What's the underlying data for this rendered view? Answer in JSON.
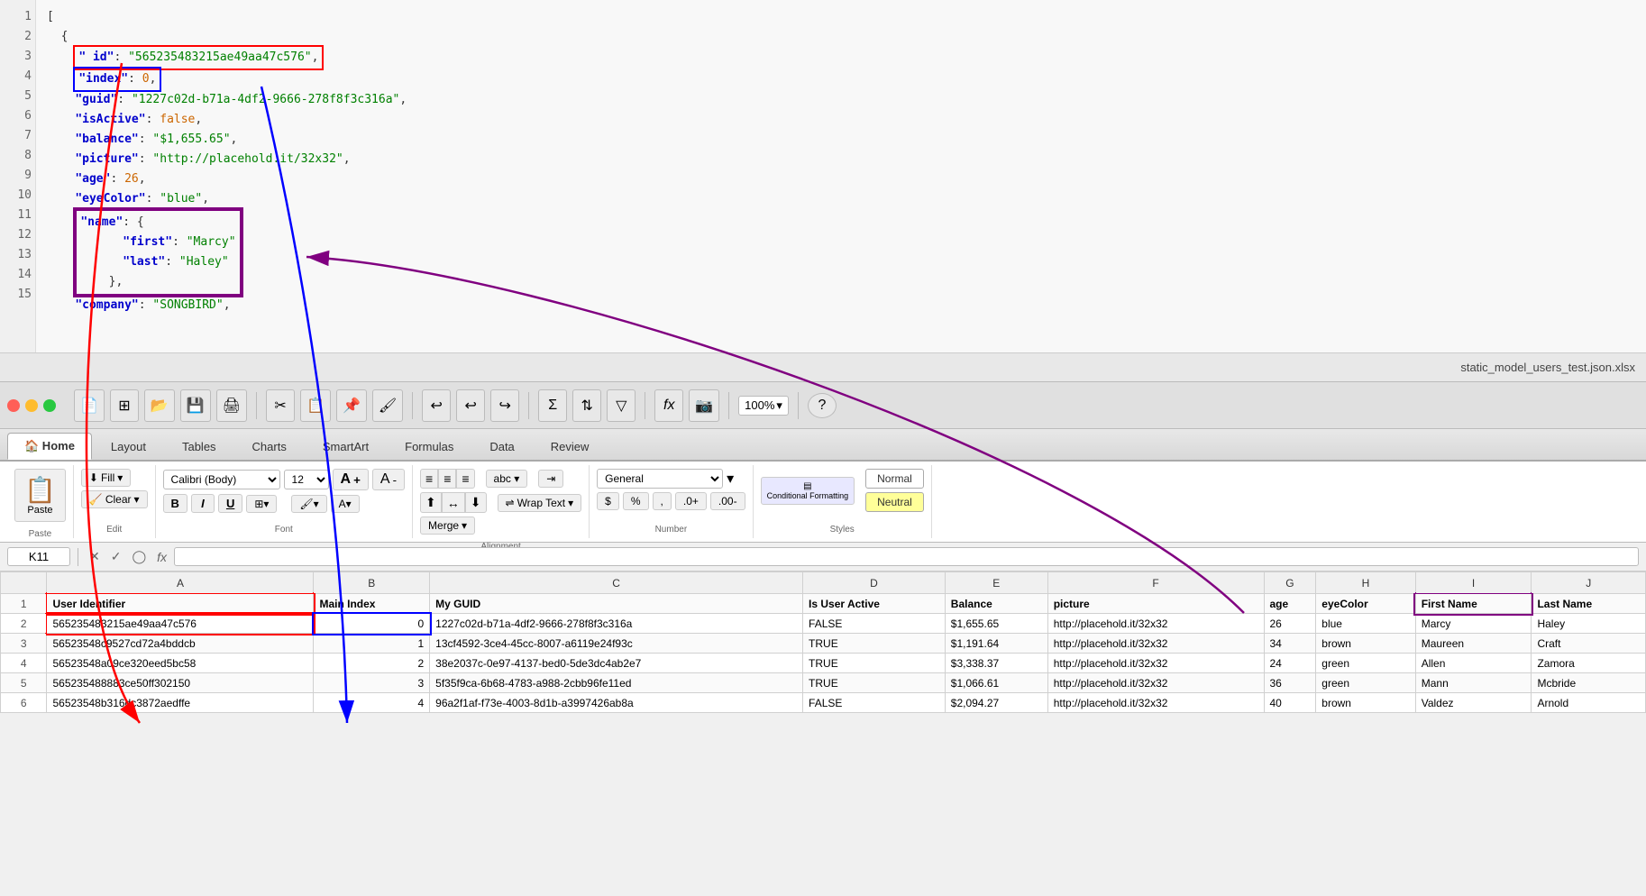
{
  "window": {
    "title": "static_model_users_test.json.xlsx"
  },
  "editor": {
    "lines": [
      {
        "num": 1,
        "content": "["
      },
      {
        "num": 2,
        "content": "  {"
      },
      {
        "num": 3,
        "content": "    \" id\": \"565235483215ae49aa47c576\","
      },
      {
        "num": 4,
        "content": "    \"index\": 0,"
      },
      {
        "num": 5,
        "content": "    \"guid\": \"1227c02d-b71a-4df2-9666-278f8f3c316a\","
      },
      {
        "num": 6,
        "content": "    \"isActive\": false,"
      },
      {
        "num": 7,
        "content": "    \"balance\": \"$1,655.65\","
      },
      {
        "num": 8,
        "content": "    \"picture\": \"http://placehold.it/32x32\","
      },
      {
        "num": 9,
        "content": "    \"age\": 26,"
      },
      {
        "num": 10,
        "content": "    \"eyeColor\": \"blue\","
      },
      {
        "num": 11,
        "content": "    \"name\": {"
      },
      {
        "num": 12,
        "content": "      \"first\": \"Marcy\""
      },
      {
        "num": 13,
        "content": "      \"last\": \"Haley\""
      },
      {
        "num": 14,
        "content": "    },"
      },
      {
        "num": 15,
        "content": "    \"company\": \"SONGBIRD\","
      }
    ]
  },
  "toolbar": {
    "zoom": "100%",
    "items": [
      "new",
      "grid",
      "open",
      "save",
      "print",
      "cut",
      "copy",
      "paste",
      "format",
      "undo",
      "undo2",
      "redo",
      "sum",
      "sort",
      "filter",
      "formula",
      "camera",
      "more"
    ]
  },
  "menu_tabs": [
    {
      "label": "Home",
      "icon": "🏠",
      "active": true
    },
    {
      "label": "Layout",
      "active": false
    },
    {
      "label": "Tables",
      "active": false
    },
    {
      "label": "Charts",
      "active": false
    },
    {
      "label": "SmartArt",
      "active": false
    },
    {
      "label": "Formulas",
      "active": false
    },
    {
      "label": "Data",
      "active": false
    },
    {
      "label": "Review",
      "active": false
    }
  ],
  "ribbon": {
    "groups": {
      "edit": {
        "label": "Edit",
        "fill": "Fill",
        "clear": "Clear"
      },
      "paste": {
        "label": "Paste"
      },
      "font": {
        "label": "Font",
        "family": "Calibri (Body)",
        "size": "12",
        "bold": "B",
        "italic": "I",
        "underline": "U"
      },
      "alignment": {
        "label": "Alignment",
        "wrap_text": "Wrap Text",
        "merge": "Merge"
      },
      "number": {
        "label": "Number",
        "format": "General"
      },
      "styles": {
        "label": "Styles",
        "conditional_formatting": "Conditional Formatting",
        "normal": "Normal",
        "neutral": "Neutral"
      }
    }
  },
  "formula_bar": {
    "cell_ref": "K11",
    "formula": ""
  },
  "spreadsheet": {
    "columns": [
      "A",
      "B",
      "C",
      "D",
      "E",
      "F",
      "G",
      "H",
      "I",
      "J"
    ],
    "headers": {
      "A": "User Identifier",
      "B": "Main Index",
      "C": "My GUID",
      "D": "Is User Active",
      "E": "Balance",
      "F": "picture",
      "G": "age",
      "H": "eyeColor",
      "I": "First Name",
      "J": "Last Name"
    },
    "rows": [
      {
        "row": 2,
        "A": "565235483215ae49aa47c576",
        "B": "0",
        "C": "1227c02d-b71a-4df2-9666-278f8f3c316a",
        "D": "FALSE",
        "E": "$1,655.65",
        "F": "http://placehold.it/32x32",
        "G": "26",
        "H": "blue",
        "I": "Marcy",
        "J": "Haley"
      },
      {
        "row": 3,
        "A": "56523548c9527cd72a4bddcb",
        "B": "1",
        "C": "13cf4592-3ce4-45cc-8007-a6119e24f93c",
        "D": "TRUE",
        "E": "$1,191.64",
        "F": "http://placehold.it/32x32",
        "G": "34",
        "H": "brown",
        "I": "Maureen",
        "J": "Craft"
      },
      {
        "row": 4,
        "A": "56523548a09ce320eed5bc58",
        "B": "2",
        "C": "38e2037c-0e97-4137-bed0-5de3dc4ab2e7",
        "D": "TRUE",
        "E": "$3,338.37",
        "F": "http://placehold.it/32x32",
        "G": "24",
        "H": "green",
        "I": "Allen",
        "J": "Zamora"
      },
      {
        "row": 5,
        "A": "565235488883ce50ff302150",
        "B": "3",
        "C": "5f35f9ca-6b68-4783-a988-2cbb96fe11ed",
        "D": "TRUE",
        "E": "$1,066.61",
        "F": "http://placehold.it/32x32",
        "G": "36",
        "H": "green",
        "I": "Mann",
        "J": "Mcbride"
      },
      {
        "row": 6,
        "A": "56523548b316dc3872aedffe",
        "B": "4",
        "C": "96a2f1af-f73e-4003-8d1b-a3997426ab8a",
        "D": "FALSE",
        "E": "$2,094.27",
        "F": "http://placehold.it/32x32",
        "G": "40",
        "H": "brown",
        "I": "Valdez",
        "J": "Arnold"
      }
    ]
  }
}
